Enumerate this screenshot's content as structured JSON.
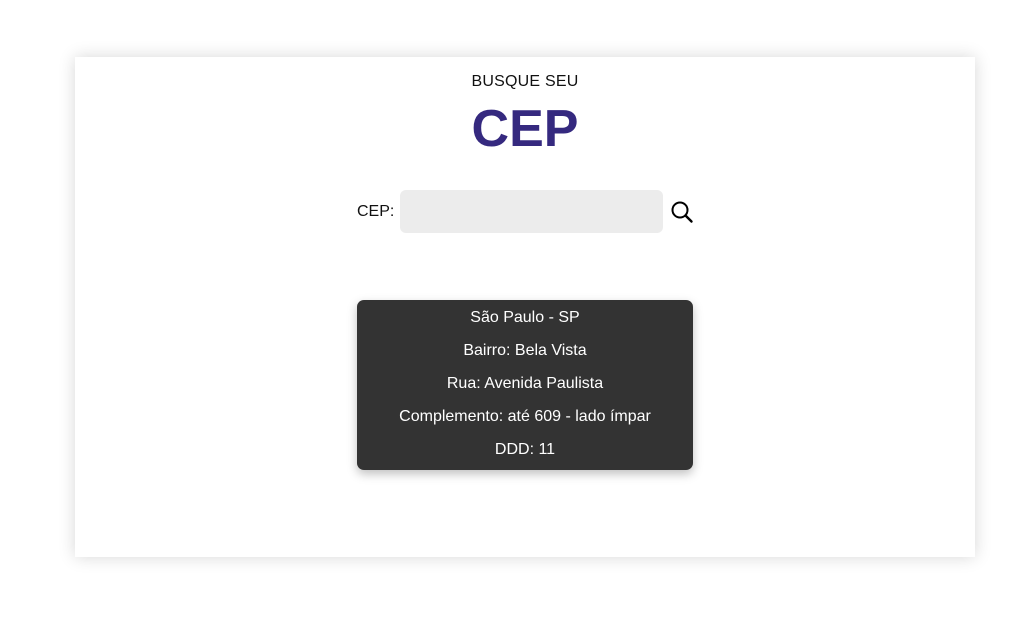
{
  "header": {
    "subtitle": "BUSQUE SEU",
    "title": "CEP"
  },
  "search": {
    "label": "CEP:",
    "value": "",
    "placeholder": "",
    "button_icon": "search-icon"
  },
  "result": {
    "city_state": "São Paulo - SP",
    "bairro": "Bairro: Bela Vista",
    "rua": "Rua: Avenida Paulista",
    "complemento": "Complemento: até 609 - lado ímpar",
    "ddd": "DDD: 11"
  },
  "colors": {
    "title": "#35297f",
    "input_bg": "#ececec",
    "result_bg": "#333333",
    "result_text": "#ffffff"
  }
}
